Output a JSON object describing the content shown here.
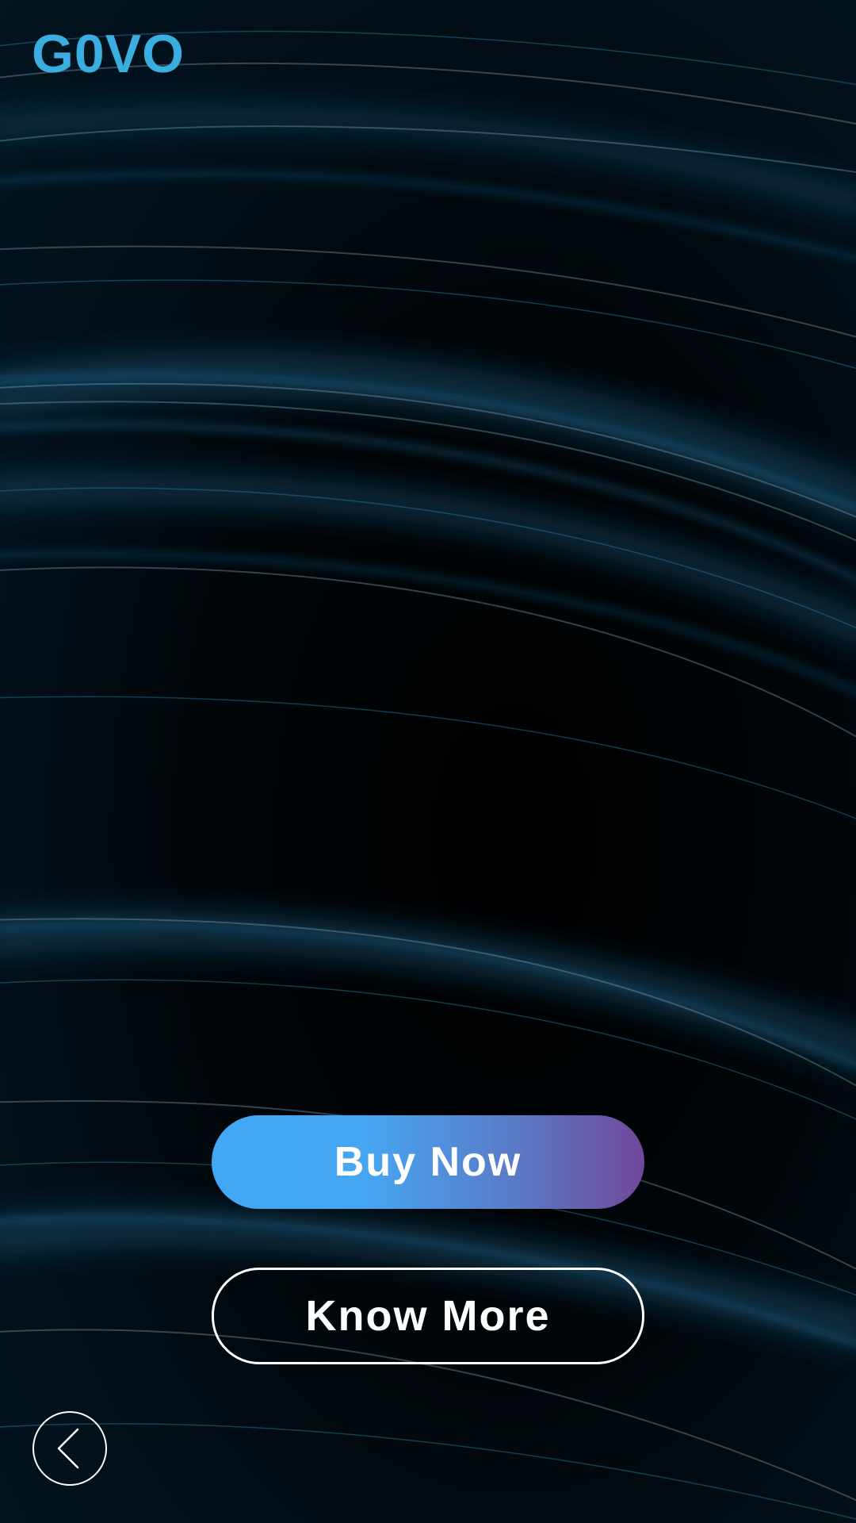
{
  "app": {
    "logo_text": "G0VO"
  },
  "actions": {
    "buy_label": "Buy Now",
    "know_label": "Know More"
  },
  "navigation": {
    "back_icon": "chevron-left-icon"
  },
  "colors": {
    "logo": "#3aaee0",
    "buy_gradient_start": "#42a8f4",
    "buy_gradient_end": "#71479a",
    "background": "#000000",
    "wave_highlight": "#1d6a90"
  }
}
